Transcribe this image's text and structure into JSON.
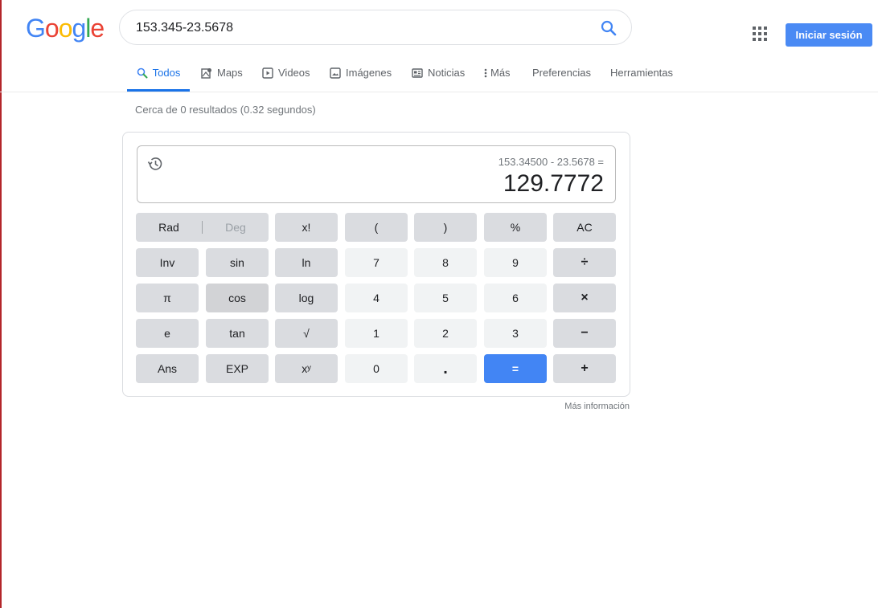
{
  "logo": {
    "letters": [
      "G",
      "o",
      "o",
      "g",
      "l",
      "e"
    ],
    "colors": [
      "#4285f4",
      "#ea4335",
      "#fbbc05",
      "#4285f4",
      "#34a853",
      "#ea4335"
    ]
  },
  "search": {
    "query": "153.345-23.5678",
    "button_icon": "search-icon"
  },
  "header": {
    "apps_icon": "apps-grid-icon",
    "signin_label": "Iniciar sesión",
    "signin_color": "#4a8af4"
  },
  "tabs": [
    {
      "label": "Todos",
      "icon": "search-icon",
      "active": true
    },
    {
      "label": "Maps",
      "icon": "map-icon"
    },
    {
      "label": "Videos",
      "icon": "play-icon"
    },
    {
      "label": "Imágenes",
      "icon": "image-icon"
    },
    {
      "label": "Noticias",
      "icon": "news-icon"
    },
    {
      "label": "Más",
      "icon": "more-vert-icon"
    },
    {
      "label": "Preferencias"
    },
    {
      "label": "Herramientas"
    }
  ],
  "result_stats": "Cerca de 0 resultados (0.32 segundos)",
  "calculator": {
    "expression": "153.34500 - 23.5678 =",
    "result": "129.7772",
    "history_icon": "history-icon",
    "angle_modes": {
      "rad": "Rad",
      "deg": "Deg",
      "selected": "Rad"
    },
    "rows": [
      [
        "x!",
        "(",
        ")",
        "%",
        "AC"
      ],
      [
        "Inv",
        "sin",
        "ln",
        "7",
        "8",
        "9",
        "÷"
      ],
      [
        "π",
        "cos",
        "log",
        "4",
        "5",
        "6",
        "×"
      ],
      [
        "e",
        "tan",
        "√",
        "1",
        "2",
        "3",
        "−"
      ],
      [
        "Ans",
        "EXP",
        "xʸ",
        "0",
        ".",
        "=",
        "+"
      ]
    ],
    "accent_color": "#4285f4"
  },
  "more_info": "Más información"
}
